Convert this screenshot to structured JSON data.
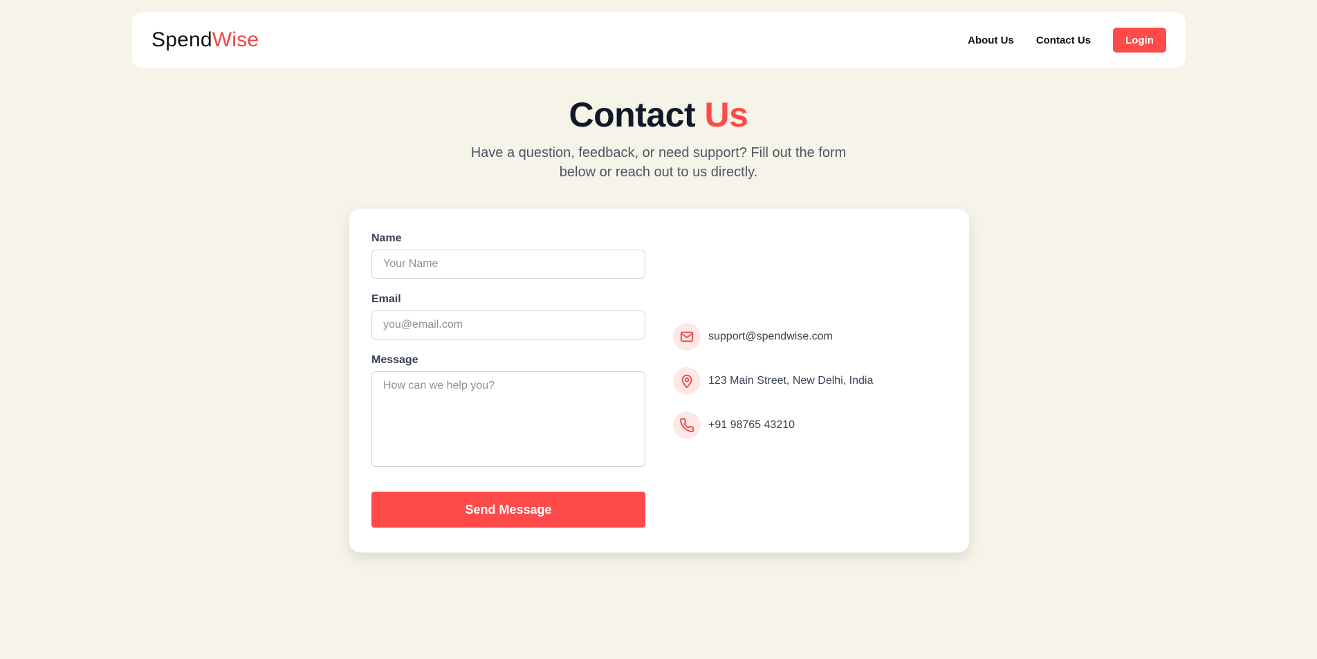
{
  "brand": {
    "part1": "Spend",
    "part2": "Wise"
  },
  "nav": {
    "about": "About Us",
    "contact": "Contact Us",
    "login": "Login"
  },
  "hero": {
    "title_a": "Contact",
    "title_b": "Us",
    "subtitle": "Have a question, feedback, or need support? Fill out the form below or reach out to us directly."
  },
  "form": {
    "name_label": "Name",
    "name_placeholder": "Your Name",
    "email_label": "Email",
    "email_placeholder": "you@email.com",
    "message_label": "Message",
    "message_placeholder": "How can we help you?",
    "submit": "Send Message"
  },
  "contact_info": {
    "email": "support@spendwise.com",
    "address": "123 Main Street, New Delhi, India",
    "phone": "+91 98765 43210"
  },
  "icons": {
    "email": "mail-icon",
    "address": "map-pin-icon",
    "phone": "phone-icon"
  },
  "colors": {
    "accent": "#ff4a4a",
    "background": "#f6f3e9",
    "icon_bg": "#fde8e8"
  }
}
